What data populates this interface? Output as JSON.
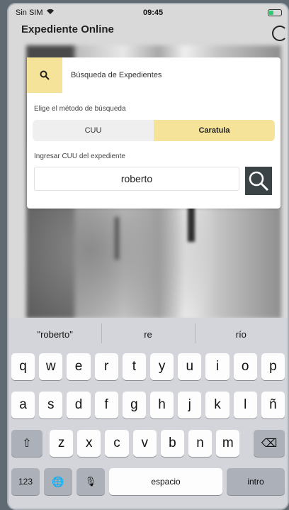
{
  "status": {
    "carrier": "Sin SIM",
    "time": "09:45"
  },
  "nav": {
    "title": "Expediente Online"
  },
  "search_card": {
    "title": "Búsqueda de Expedientes",
    "method_label": "Elige el método de búsqueda",
    "segments": [
      {
        "label": "CUU",
        "active": false
      },
      {
        "label": "Caratula",
        "active": true
      }
    ],
    "input_label": "Ingresar CUU del expediente",
    "input_value": "roberto",
    "accent_color": "#f6e39a"
  },
  "keyboard": {
    "suggestions": [
      "\"roberto\"",
      "re",
      "río"
    ],
    "row1": [
      "q",
      "w",
      "e",
      "r",
      "t",
      "y",
      "u",
      "i",
      "o",
      "p"
    ],
    "row2": [
      "a",
      "s",
      "d",
      "f",
      "g",
      "h",
      "j",
      "k",
      "l",
      "ñ"
    ],
    "row3": [
      "z",
      "x",
      "c",
      "v",
      "b",
      "n",
      "m"
    ],
    "numbers_key": "123",
    "space_key": "espacio",
    "return_key": "intro"
  }
}
